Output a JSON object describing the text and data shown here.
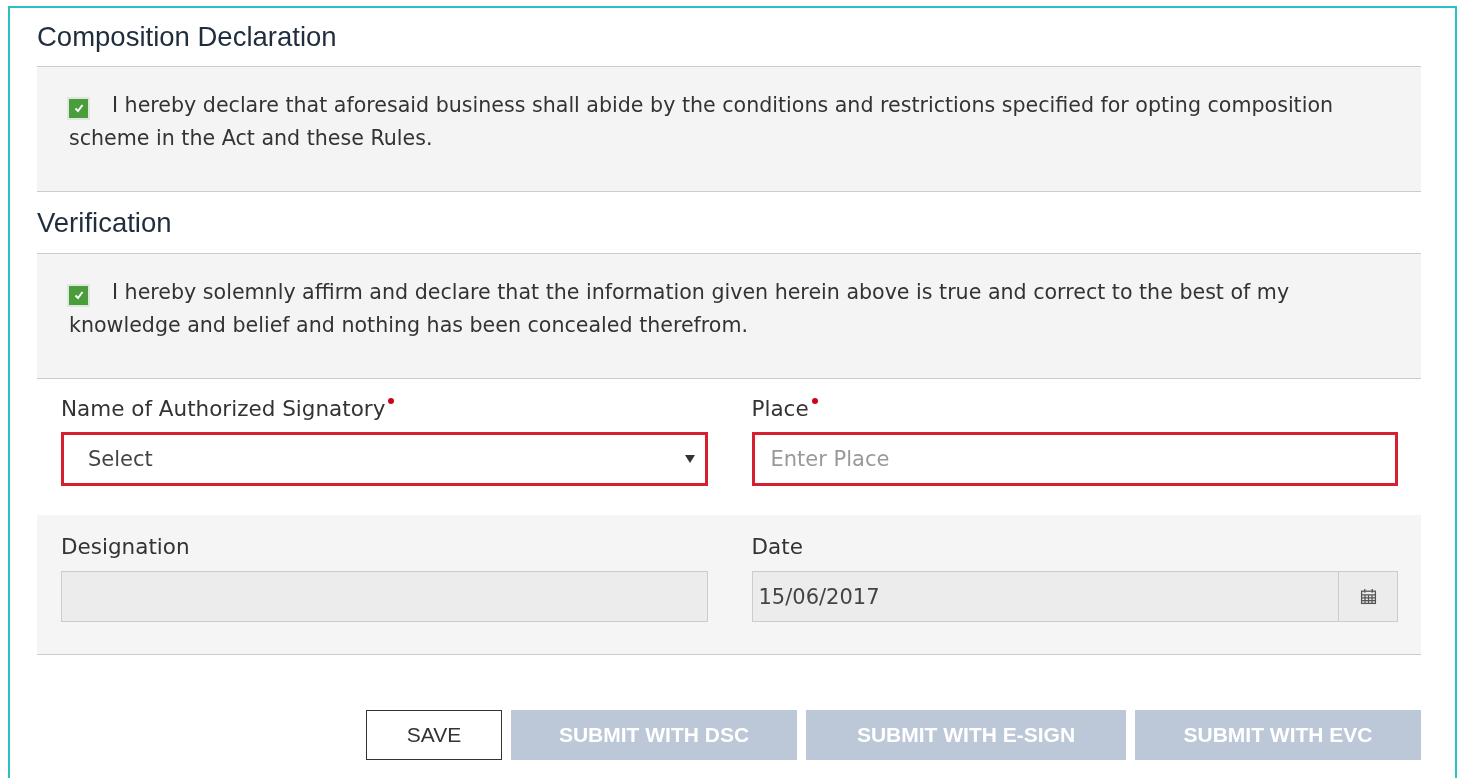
{
  "sections": [
    {
      "title": "Composition Declaration",
      "declaration": {
        "checked": true,
        "text": "I hereby declare that aforesaid business shall abide by the conditions and restrictions specified for opting composition scheme in the Act and these Rules."
      }
    },
    {
      "title": "Verification",
      "declaration": {
        "checked": true,
        "text": "I hereby solemnly affirm and declare that the information given herein above is true and correct to the best of my knowledge and belief and nothing has been concealed therefrom."
      }
    }
  ],
  "field_rows": [
    {
      "shaded": false,
      "fields": [
        {
          "kind": "select",
          "label": "Name of Authorized Signatory",
          "required": true,
          "invalid": true,
          "disabled": false,
          "value": "Select"
        },
        {
          "kind": "text",
          "label": "Place",
          "required": true,
          "invalid": true,
          "disabled": false,
          "placeholder": "Enter Place"
        }
      ]
    },
    {
      "shaded": true,
      "fields": [
        {
          "kind": "text",
          "label": "Designation",
          "required": false,
          "invalid": false,
          "disabled": true
        },
        {
          "kind": "date",
          "label": "Date",
          "required": false,
          "invalid": false,
          "disabled": true,
          "value": "15/06/2017"
        }
      ]
    }
  ],
  "buttons": [
    {
      "label": "SAVE",
      "disabled": false
    },
    {
      "label": "SUBMIT WITH DSC",
      "disabled": true
    },
    {
      "label": "SUBMIT WITH E-SIGN",
      "disabled": true
    },
    {
      "label": "SUBMIT WITH EVC",
      "disabled": true
    }
  ]
}
